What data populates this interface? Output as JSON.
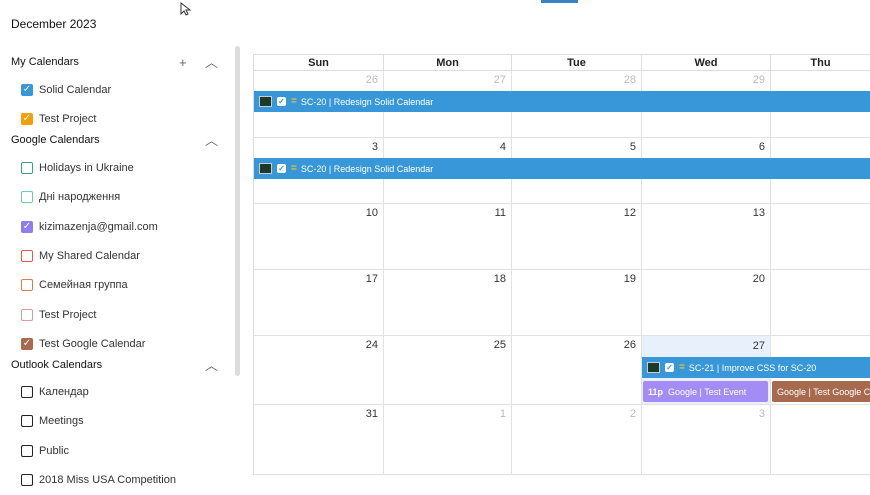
{
  "header": {
    "title": "December 2023"
  },
  "colors": {
    "accent": "#3797d9",
    "google_event": "#a38cf5",
    "test_google": "#a86a4f"
  },
  "sidebar": {
    "my_calendars": {
      "title": "My Calendars",
      "add": "+",
      "collapse": "︿"
    },
    "my_items": [
      {
        "label": "Solid Calendar",
        "color": "#3797d9",
        "checked": true
      },
      {
        "label": "Test Project",
        "color": "#f59e0b",
        "checked": true
      }
    ],
    "google_calendars": {
      "title": "Google Calendars",
      "collapse": "︿"
    },
    "google_items": [
      {
        "label": "Holidays in Ukraine",
        "color": "#3aa37a",
        "checked": false
      },
      {
        "label": "Дні народження",
        "color": "#6fcaa6",
        "checked": false
      },
      {
        "label": "kizimazenja@gmail.com",
        "color": "#8e7cf0",
        "checked": true
      },
      {
        "label": "My Shared Calendar",
        "color": "#e05a4a",
        "checked": false
      },
      {
        "label": "Семейная группа",
        "color": "#e07a4a",
        "checked": false
      },
      {
        "label": "Test Project",
        "color": "#d99a9a",
        "checked": false
      },
      {
        "label": "Test Google Calendar",
        "color": "#a86a4f",
        "checked": true
      }
    ],
    "outlook_calendars": {
      "title": "Outlook Calendars",
      "collapse": "︿"
    },
    "outlook_items": [
      {
        "label": "Календар",
        "color": "#222222",
        "checked": false
      },
      {
        "label": "Meetings",
        "color": "#222222",
        "checked": false
      },
      {
        "label": "Public",
        "color": "#222222",
        "checked": false
      },
      {
        "label": "2018 Miss USA Competition",
        "color": "#222222",
        "checked": false
      }
    ]
  },
  "calendar": {
    "days_of_week": [
      "Sun",
      "Mon",
      "Tue",
      "Wed",
      "Thu"
    ],
    "weeks": [
      [
        {
          "d": "26",
          "m": true
        },
        {
          "d": "27",
          "m": true
        },
        {
          "d": "28",
          "m": true
        },
        {
          "d": "29",
          "m": true
        },
        {
          "d": "",
          "m": false
        }
      ],
      [
        {
          "d": "3",
          "m": false
        },
        {
          "d": "4",
          "m": false
        },
        {
          "d": "5",
          "m": false
        },
        {
          "d": "6",
          "m": false
        },
        {
          "d": "",
          "m": false
        }
      ],
      [
        {
          "d": "10",
          "m": false
        },
        {
          "d": "11",
          "m": false
        },
        {
          "d": "12",
          "m": false
        },
        {
          "d": "13",
          "m": false
        },
        {
          "d": "",
          "m": false
        }
      ],
      [
        {
          "d": "17",
          "m": false
        },
        {
          "d": "18",
          "m": false
        },
        {
          "d": "19",
          "m": false
        },
        {
          "d": "20",
          "m": false
        },
        {
          "d": "",
          "m": false
        }
      ],
      [
        {
          "d": "24",
          "m": false
        },
        {
          "d": "25",
          "m": false
        },
        {
          "d": "26",
          "m": false
        },
        {
          "d": "27",
          "m": false
        },
        {
          "d": "",
          "m": false
        }
      ],
      [
        {
          "d": "31",
          "m": false
        },
        {
          "d": "1",
          "m": true
        },
        {
          "d": "2",
          "m": true
        },
        {
          "d": "3",
          "m": true
        },
        {
          "d": "",
          "m": false
        }
      ]
    ],
    "events": {
      "week1_bar": "SC-20 | Redesign Solid Calendar",
      "week2_bar": "SC-20 | Redesign Solid Calendar",
      "dec27_bar": "SC-21 | Improve CSS for SC-20",
      "google_time": "11p",
      "google_event": "Google | Test Event",
      "test_google_event": "Google | Test Google C"
    }
  }
}
